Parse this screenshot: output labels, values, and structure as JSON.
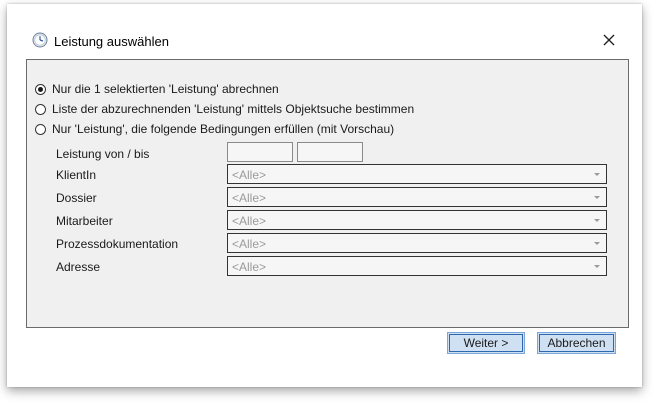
{
  "dialog": {
    "title": "Leistung auswählen",
    "icon": "clock-icon"
  },
  "options": [
    {
      "label": "Nur die 1 selektierten 'Leistung' abrechnen",
      "selected": true
    },
    {
      "label": "Liste der abzurechnenden 'Leistung' mittels Objektsuche bestimmen",
      "selected": false
    },
    {
      "label": "Nur 'Leistung', die folgende Bedingungen erfüllen (mit Vorschau)",
      "selected": false
    }
  ],
  "filters": {
    "date_range_label": "Leistung von / bis",
    "date_from": "",
    "date_to": "",
    "fields": [
      {
        "label": "KlientIn",
        "value": "<Alle>"
      },
      {
        "label": "Dossier",
        "value": "<Alle>"
      },
      {
        "label": "Mitarbeiter",
        "value": "<Alle>"
      },
      {
        "label": "Prozessdokumentation",
        "value": "<Alle>"
      },
      {
        "label": "Adresse",
        "value": "<Alle>"
      }
    ]
  },
  "buttons": {
    "next": "Weiter >",
    "cancel": "Abbrechen"
  }
}
